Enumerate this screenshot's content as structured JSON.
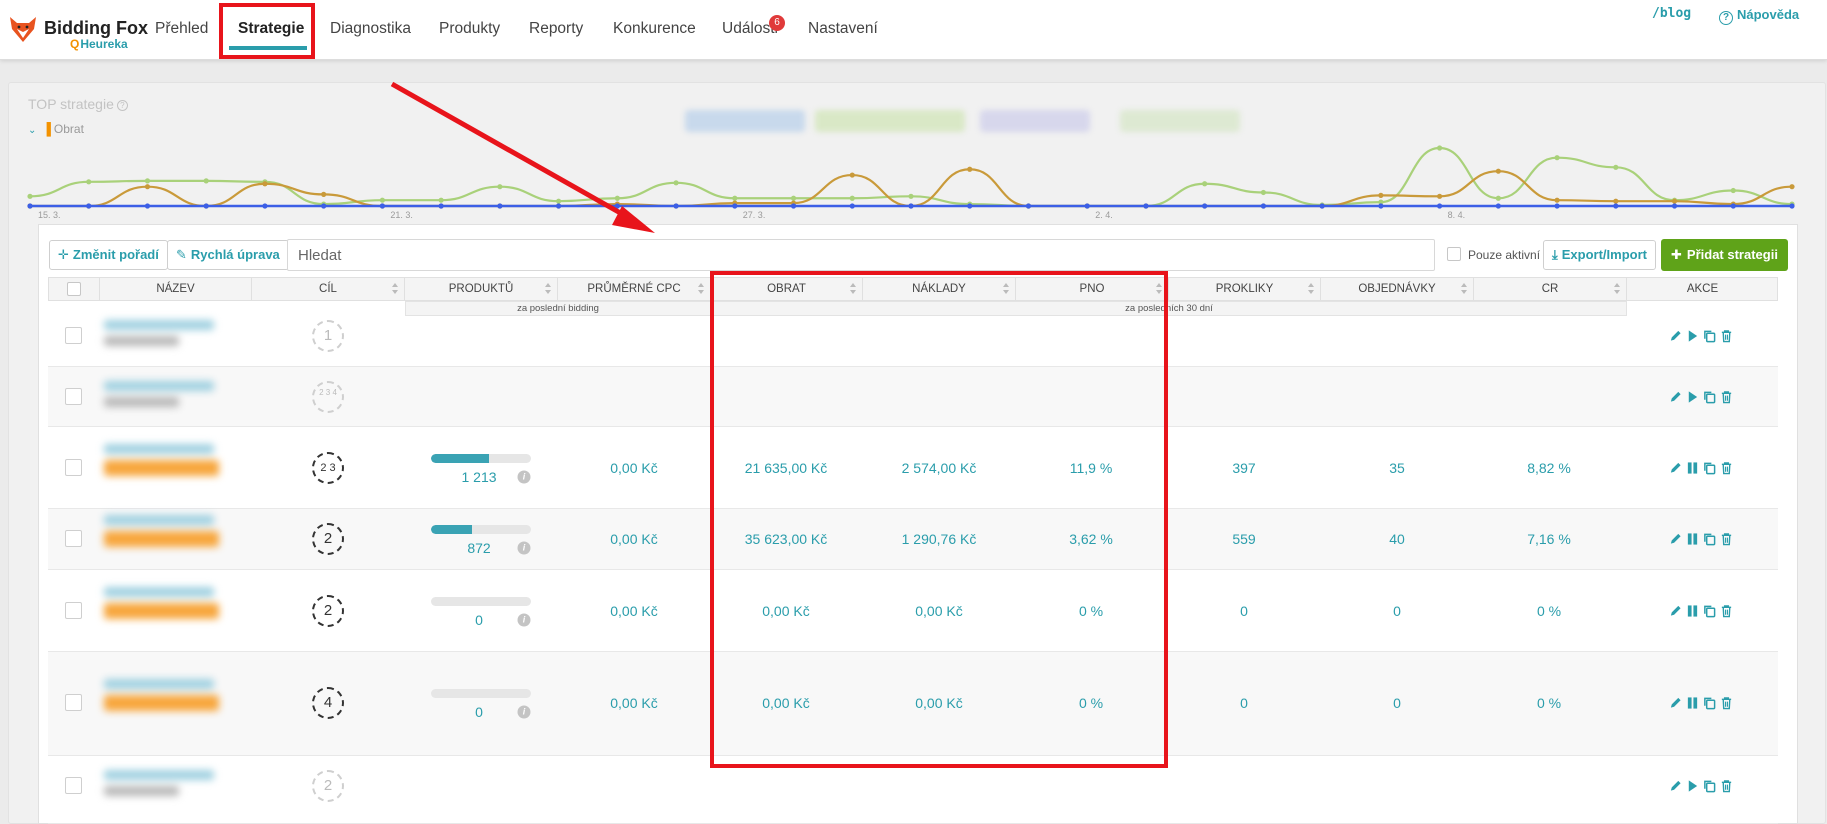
{
  "brand": {
    "name": "Bidding Fox",
    "sub": "Heureka"
  },
  "nav": {
    "items": [
      "Přehled",
      "Strategie",
      "Diagnostika",
      "Produkty",
      "Reporty",
      "Konkurence",
      "Události",
      "Nastavení"
    ],
    "active": "Strategie",
    "events_badge": "6",
    "blog": "/blog",
    "help": "Nápověda"
  },
  "chart": {
    "title": "TOP strategie",
    "metric_label": "Obrat",
    "colors": {
      "series_blue": "#3c5fe6",
      "series_green": "#a9d17a",
      "series_gold": "#c99a3a"
    },
    "x_tick_labels": [
      "15. 3.",
      "21. 3.",
      "27. 3.",
      "2. 4.",
      "8. 4."
    ]
  },
  "chart_data": {
    "type": "line",
    "title": "TOP strategie",
    "series": [
      {
        "color": "#3c5fe6",
        "values": [
          0,
          0,
          0,
          0,
          0,
          0,
          0,
          0,
          0,
          0,
          0,
          0,
          0,
          0,
          0,
          0,
          0,
          0,
          0,
          0,
          0,
          0,
          0,
          0,
          0,
          0,
          0,
          0,
          0,
          0,
          0
        ]
      },
      {
        "color": "#a9d17a",
        "values": [
          10,
          25,
          26,
          26,
          25,
          2,
          6,
          6,
          20,
          5,
          8,
          24,
          8,
          8,
          8,
          10,
          2,
          0,
          0,
          0,
          23,
          14,
          1,
          4,
          60,
          8,
          50,
          40,
          6,
          16,
          2
        ]
      },
      {
        "color": "#c99a3a",
        "values": [
          0,
          0,
          20,
          0,
          23,
          12,
          0,
          0,
          0,
          0,
          2,
          0,
          3,
          3,
          32,
          0,
          38,
          0,
          0,
          0,
          0,
          0,
          0,
          11,
          10,
          36,
          6,
          5,
          5,
          2,
          20
        ]
      }
    ],
    "ylim": [
      0,
      60
    ],
    "grid": false
  },
  "toolbar": {
    "reorder": "Změnit pořadí",
    "quick_edit": "Rychlá úprava",
    "search_placeholder": "Hledat",
    "only_active": "Pouze aktivní",
    "export_import": "Export/Import",
    "add_strategy": "Přidat strategii"
  },
  "table": {
    "columns": [
      "NÁZEV",
      "CÍL",
      "PRODUKTŮ",
      "PRŮMĚRNÉ CPC",
      "OBRAT",
      "NÁKLADY",
      "PNO",
      "PROKLIKY",
      "OBJEDNÁVKY",
      "CR",
      "AKCE"
    ],
    "subheader_bidding": "za poslední bidding",
    "subheader_30days": "za posledních 30 dní",
    "rows": [
      {
        "goal": "1",
        "goal_active": false,
        "has_data": false,
        "active": true
      },
      {
        "goal": "2 3 4",
        "goal_active": false,
        "has_data": false,
        "active": true
      },
      {
        "goal": "2 3",
        "goal_active": true,
        "has_data": true,
        "active": false,
        "products": "1 213",
        "products_fill": 0.58,
        "cpc": "0,00 Kč",
        "revenue": "21 635,00 Kč",
        "costs": "2 574,00 Kč",
        "pno": "11,9 %",
        "clicks": "397",
        "orders": "35",
        "cr": "8,82 %"
      },
      {
        "goal": "2",
        "goal_active": true,
        "has_data": true,
        "active": false,
        "products": "872",
        "products_fill": 0.41,
        "cpc": "0,00 Kč",
        "revenue": "35 623,00 Kč",
        "costs": "1 290,76 Kč",
        "pno": "3,62 %",
        "clicks": "559",
        "orders": "40",
        "cr": "7,16 %"
      },
      {
        "goal": "2",
        "goal_active": true,
        "has_data": true,
        "active": false,
        "products": "0",
        "products_fill": 0,
        "cpc": "0,00 Kč",
        "revenue": "0,00 Kč",
        "costs": "0,00 Kč",
        "pno": "0 %",
        "clicks": "0",
        "orders": "0",
        "cr": "0 %"
      },
      {
        "goal": "4",
        "goal_active": true,
        "has_data": true,
        "active": false,
        "products": "0",
        "products_fill": 0,
        "cpc": "0,00 Kč",
        "revenue": "0,00 Kč",
        "costs": "0,00 Kč",
        "pno": "0 %",
        "clicks": "0",
        "orders": "0",
        "cr": "0 %"
      },
      {
        "goal": "2",
        "goal_active": false,
        "has_data": false,
        "active": true
      }
    ]
  },
  "annotation": {
    "color": "#e8141b"
  }
}
